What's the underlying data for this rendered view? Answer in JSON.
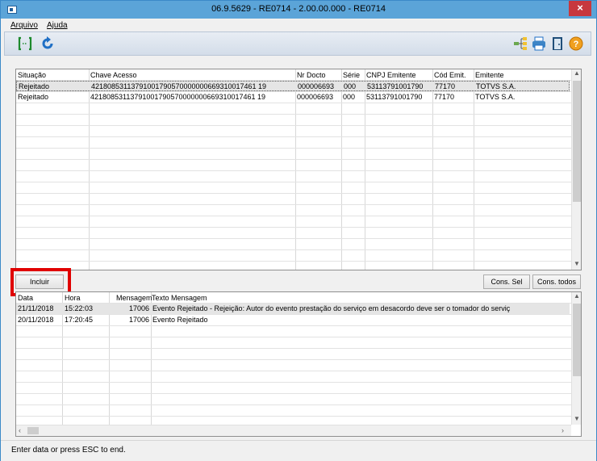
{
  "window": {
    "title": "06.9.5629 - RE0714 - 2.00.00.000 - RE0714",
    "close": "×"
  },
  "menu": {
    "items": [
      "Arquivo",
      "Ajuda"
    ]
  },
  "top_grid": {
    "columns": [
      "Situação",
      "Chave Acesso",
      "Nr Docto",
      "Série",
      "CNPJ Emitente",
      "Cód Emit.",
      "Emitente"
    ],
    "rows": [
      [
        "Rejeitado",
        "42180853113791001790570000000669310017461 19",
        "000006693",
        "000",
        "53113791001790",
        "77170",
        "TOTVS S.A."
      ],
      [
        "Rejeitado",
        "42180853113791001790570000000669310017461 19",
        "000006693",
        "000",
        "53113791001790",
        "77170",
        "TOTVS S.A."
      ]
    ]
  },
  "buttons": {
    "incluir": "Incluir",
    "cons_sel": "Cons. Sel",
    "cons_todos": "Cons. todos"
  },
  "bottom_grid": {
    "columns": [
      "Data",
      "Hora",
      "Mensagem",
      "Texto Mensagem"
    ],
    "rows": [
      [
        "21/11/2018",
        "15:22:03",
        "17006",
        "Evento Rejeitado - Rejeição: Autor do evento prestação do serviço em desacordo deve ser o tomador do serviç"
      ],
      [
        "20/11/2018",
        "17:20:45",
        "17006",
        "Evento Rejeitado"
      ]
    ]
  },
  "status": {
    "text": "Enter data or press ESC to end."
  },
  "colors": {
    "highlight": "#e00000",
    "selected_row": "#e5e5e5",
    "titlebar": "#5ba4d8"
  }
}
